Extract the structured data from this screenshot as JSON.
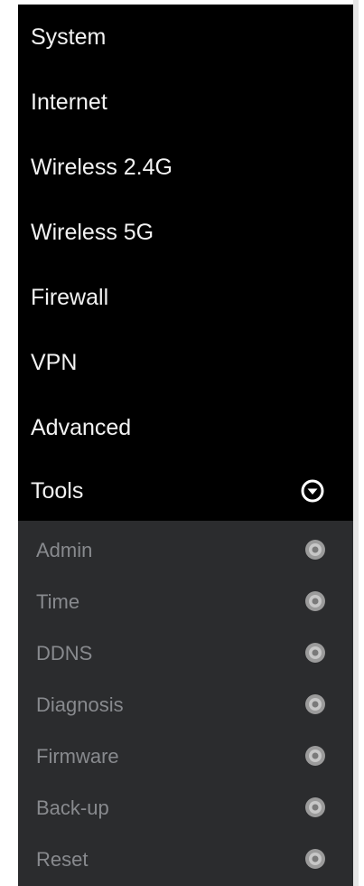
{
  "menu": {
    "items": [
      {
        "label": "System"
      },
      {
        "label": "Internet"
      },
      {
        "label": "Wireless 2.4G"
      },
      {
        "label": "Wireless 5G"
      },
      {
        "label": "Firewall"
      },
      {
        "label": "VPN"
      },
      {
        "label": "Advanced"
      },
      {
        "label": "Tools",
        "icon": "chevron-down-circle-icon",
        "expanded": true
      }
    ]
  },
  "submenu": {
    "items": [
      {
        "label": "Admin",
        "icon": "radio-bullet-icon"
      },
      {
        "label": "Time",
        "icon": "radio-bullet-icon"
      },
      {
        "label": "DDNS",
        "icon": "radio-bullet-icon"
      },
      {
        "label": "Diagnosis",
        "icon": "radio-bullet-icon"
      },
      {
        "label": "Firmware",
        "icon": "radio-bullet-icon"
      },
      {
        "label": "Back-up",
        "icon": "radio-bullet-icon"
      },
      {
        "label": "Reset",
        "icon": "radio-bullet-icon"
      }
    ]
  },
  "colors": {
    "menu_bg": "#000000",
    "menu_text": "#f2f2f2",
    "submenu_bg": "#2b2c2e",
    "submenu_text": "#888a8e"
  }
}
